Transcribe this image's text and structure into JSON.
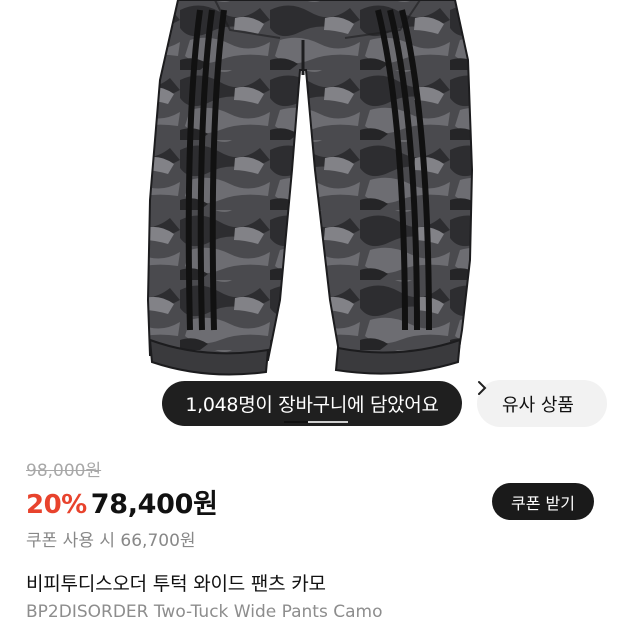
{
  "product_image": {
    "alt_icon": "camo-pants-image",
    "camo_colors": [
      "#3a3a3d",
      "#5c5c60",
      "#2a2a2c",
      "#77777b"
    ]
  },
  "cart_banner": {
    "text": "1,048명이 장바구니에 담았어요"
  },
  "similar_products": {
    "label": "유사 상품",
    "icon": "chevron-right-icon"
  },
  "price": {
    "original": "98,000원",
    "discount": "20%",
    "sale": "78,400원",
    "coupon_price_text": "쿠폰 사용 시 66,700원",
    "discount_color": "#e8432d"
  },
  "coupon_button": {
    "label": "쿠폰 받기"
  },
  "product": {
    "title_ko": "비피투디스오더 투턱 와이드 팬츠 카모",
    "title_en": "BP2DISORDER Two-Tuck Wide Pants Camo"
  }
}
